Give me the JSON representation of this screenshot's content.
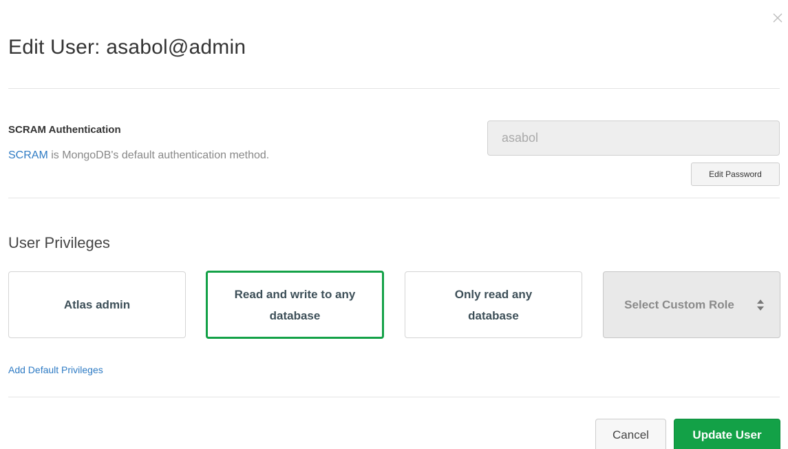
{
  "modal": {
    "title": "Edit User: asabol@admin",
    "close_icon": "close-icon"
  },
  "authentication": {
    "heading": "SCRAM Authentication",
    "link_text": "SCRAM",
    "description": " is MongoDB's default authentication method.",
    "username_value": "asabol",
    "edit_password_label": "Edit Password"
  },
  "privileges": {
    "heading": "User Privileges",
    "roles": [
      {
        "label": "Atlas admin",
        "selected": false
      },
      {
        "label": "Read and write to any database",
        "selected": true
      },
      {
        "label": "Only read any database",
        "selected": false
      }
    ],
    "custom_role_label": "Select Custom Role",
    "custom_role_icon": "sort-icon",
    "add_default_link": "Add Default Privileges"
  },
  "footer": {
    "cancel_label": "Cancel",
    "update_label": "Update User"
  },
  "colors": {
    "accent_green": "#13a147",
    "link_blue": "#2e7bc4",
    "text_dark": "#3d4f58"
  }
}
